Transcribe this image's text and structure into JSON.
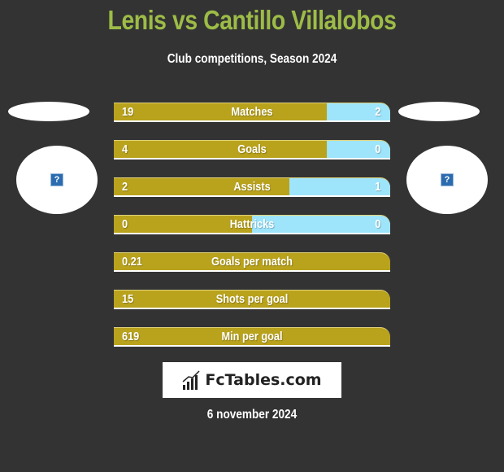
{
  "header": {
    "title": "Lenis vs Cantillo Villalobos",
    "subtitle": "Club competitions, Season 2024"
  },
  "players": {
    "left": {
      "name": "Lenis",
      "avatar_icon": "question-mark-icon"
    },
    "right": {
      "name": "Cantillo Villalobos",
      "avatar_icon": "question-mark-icon"
    }
  },
  "colors": {
    "title": "#9dbc47",
    "left_bar": "#b9a21c",
    "right_bar": "#9ee4fb",
    "background": "#333333"
  },
  "stats": [
    {
      "label": "Matches",
      "left": "19",
      "right": "2",
      "right_share": 0.23
    },
    {
      "label": "Goals",
      "left": "4",
      "right": "0",
      "right_share": 0.23
    },
    {
      "label": "Assists",
      "left": "2",
      "right": "1",
      "right_share": 0.365
    },
    {
      "label": "Hattricks",
      "left": "0",
      "right": "0",
      "right_share": 0.5
    },
    {
      "label": "Goals per match",
      "left": "0.21",
      "right": "",
      "right_share": 0
    },
    {
      "label": "Shots per goal",
      "left": "15",
      "right": "",
      "right_share": 0
    },
    {
      "label": "Min per goal",
      "left": "619",
      "right": "",
      "right_share": 0
    }
  ],
  "footer": {
    "logo_text": "FcTables.com",
    "date": "6 november 2024"
  }
}
